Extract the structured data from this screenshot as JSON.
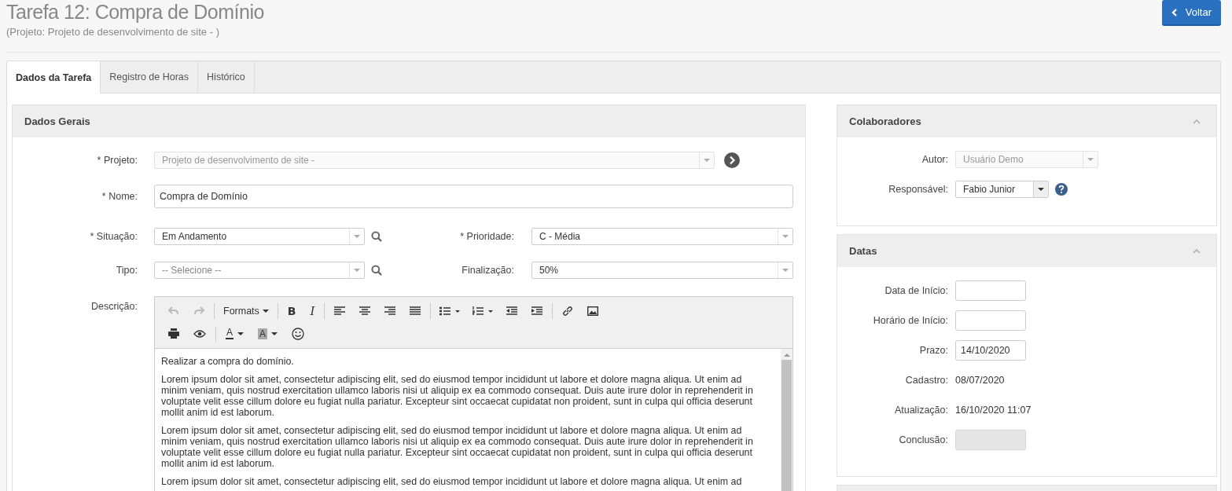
{
  "page": {
    "title": "Tarefa 12: Compra de Domínio",
    "subtitle": "(Projeto: Projeto de desenvolvimento de site - )",
    "back_button": "Voltar"
  },
  "tabs": [
    {
      "label": "Dados da Tarefa",
      "selected": true
    },
    {
      "label": "Registro de Horas",
      "selected": false
    },
    {
      "label": "Histórico",
      "selected": false
    }
  ],
  "general": {
    "title": "Dados Gerais",
    "project": {
      "label": "* Projeto:",
      "value": "Projeto de desenvolvimento de site -",
      "disabled": true
    },
    "name": {
      "label": "* Nome:",
      "value": "Compra de Domínio"
    },
    "status": {
      "label": "* Situação:",
      "value": "Em Andamento"
    },
    "priority": {
      "label": "* Prioridade:",
      "value": "C - Média"
    },
    "type": {
      "label": "Tipo:",
      "placeholder": "-- Selecione --"
    },
    "completion": {
      "label": "Finalização:",
      "value": "50%"
    },
    "description": {
      "label": "Descrição:",
      "formats_label": "Formats",
      "bold_glyph": "B",
      "italic_glyph": "I",
      "text_color_glyph": "A",
      "bg_color_glyph": "A",
      "paragraphs": [
        "Realizar a compra do domínio.",
        "Lorem ipsum dolor sit amet, consectetur adipiscing elit, sed do eiusmod tempor incididunt ut labore et dolore magna aliqua. Ut enim ad minim veniam, quis nostrud exercitation ullamco laboris nisi ut aliquip ex ea commodo consequat. Duis aute irure dolor in reprehenderit in voluptate velit esse cillum dolore eu fugiat nulla pariatur. Excepteur sint occaecat cupidatat non proident, sunt in culpa qui officia deserunt mollit anim id est laborum.",
        "Lorem ipsum dolor sit amet, consectetur adipiscing elit, sed do eiusmod tempor incididunt ut labore et dolore magna aliqua. Ut enim ad minim veniam, quis nostrud exercitation ullamco laboris nisi ut aliquip ex ea commodo consequat. Duis aute irure dolor in reprehenderit in voluptate velit esse cillum dolore eu fugiat nulla pariatur. Excepteur sint occaecat cupidatat non proident, sunt in culpa qui officia deserunt mollit anim id est laborum.",
        "Lorem ipsum dolor sit amet, consectetur adipiscing elit, sed do eiusmod tempor incididunt ut labore et dolore magna aliqua. Ut enim ad"
      ]
    }
  },
  "collaborators": {
    "title": "Colaboradores",
    "expanded": true,
    "author": {
      "label": "Autor:",
      "value": "Usuário Demo",
      "disabled": true
    },
    "responsible": {
      "label": "Responsável:",
      "value": "Fabio Junior"
    }
  },
  "dates": {
    "title": "Datas",
    "expanded": true,
    "fields": [
      {
        "kind": "input",
        "label": "Data de Início:",
        "disabled": false
      },
      {
        "kind": "input",
        "label": "Horário de Início:",
        "disabled": false
      },
      {
        "kind": "input",
        "label": "Prazo:",
        "value": "14/10/2020",
        "disabled": false
      },
      {
        "kind": "text",
        "label": "Cadastro:",
        "value": "08/07/2020"
      },
      {
        "kind": "text",
        "label": "Atualização:",
        "value": "16/10/2020 11:07"
      },
      {
        "kind": "input",
        "label": "Conclusão:",
        "disabled": true
      }
    ]
  }
}
